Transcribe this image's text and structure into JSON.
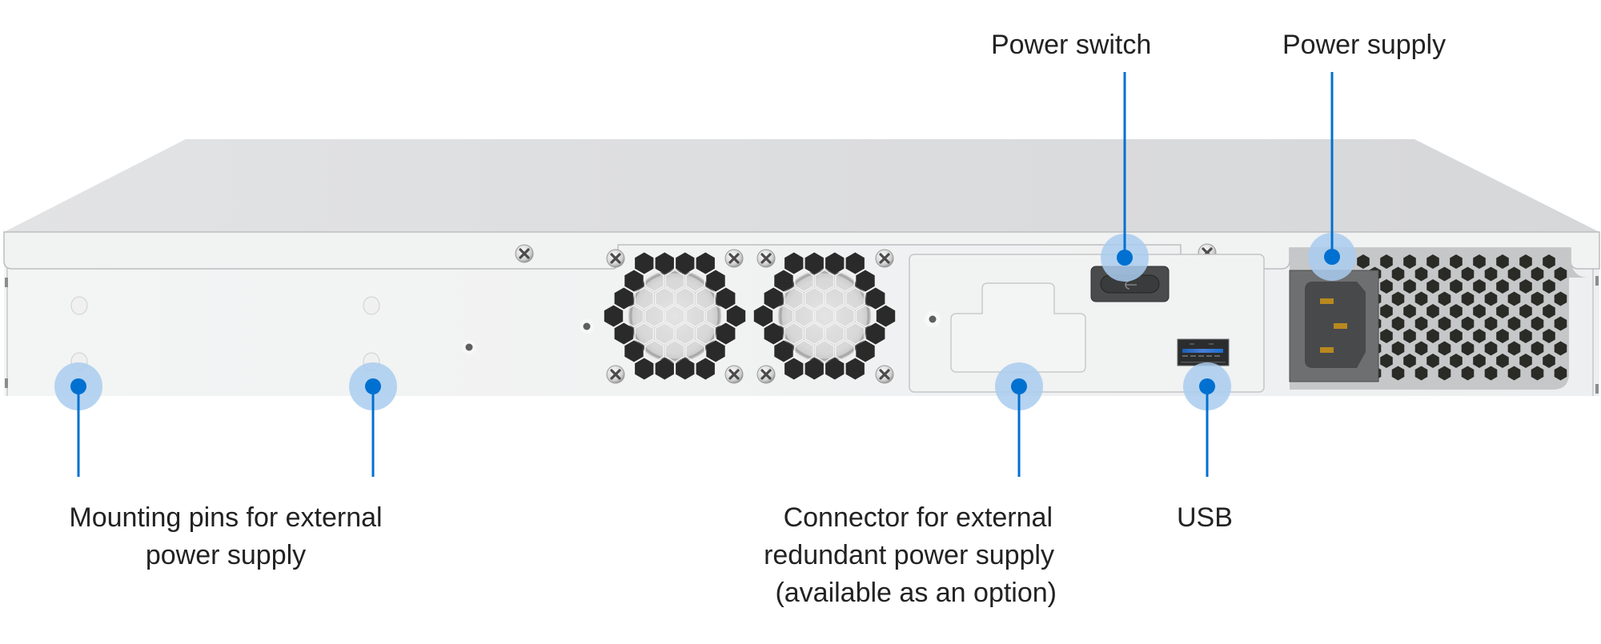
{
  "figure": {
    "subject": "Device rear panel",
    "accent_color": "#0070d1",
    "halo_color": "#a9cdee"
  },
  "callouts": [
    {
      "id": "power-switch",
      "lines": [
        "Power switch"
      ],
      "position": "top"
    },
    {
      "id": "power-supply",
      "lines": [
        "Power supply"
      ],
      "position": "top"
    },
    {
      "id": "mounting-pin-left",
      "lines": [],
      "position": "bottom"
    },
    {
      "id": "mounting-pins",
      "lines": [
        "Mounting pins for external",
        "power supply"
      ],
      "position": "bottom"
    },
    {
      "id": "redundant-connector",
      "lines": [
        "Connector for external",
        "redundant power supply",
        "(available as an option)"
      ],
      "position": "bottom"
    },
    {
      "id": "usb",
      "lines": [
        "USB"
      ],
      "position": "bottom"
    }
  ]
}
